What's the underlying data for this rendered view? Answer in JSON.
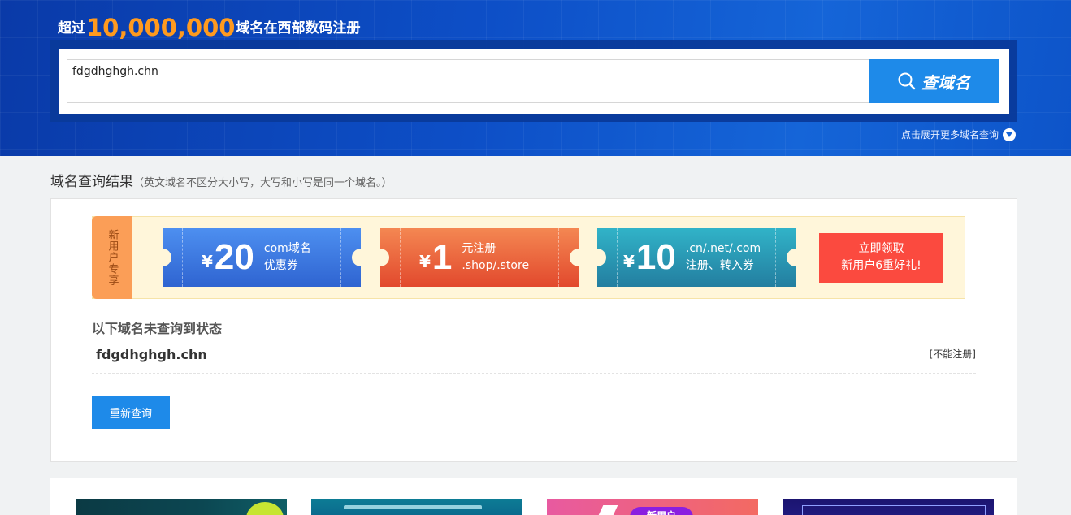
{
  "hero": {
    "title_prefix": "超过",
    "title_number": "10,000,000",
    "title_suffix": "域名在西部数码注册",
    "search_value": "fdgdhghgh.chn",
    "search_button": "查域名",
    "more_link": "点击展开更多域名查询"
  },
  "results": {
    "title": "域名查询结果",
    "note": "（英文域名不区分大小写，大写和小写是同一个域名。）",
    "promo": {
      "tag": "新用户专享",
      "coupons": [
        {
          "currency": "¥",
          "amount": "20",
          "line1": "com域名",
          "line2": "优惠券",
          "color": "#3a78e0"
        },
        {
          "currency": "¥",
          "amount": "1",
          "line1": "元注册",
          "line2": ".shop/.store",
          "color": "#ec6a3d"
        },
        {
          "currency": "¥",
          "amount": "10",
          "line1": ".cn/.net/.com",
          "line2": "注册、转入券",
          "color": "#2a99b5"
        }
      ],
      "gift_line1": "立即领取",
      "gift_line2": "新用户6重好礼!"
    },
    "fail_heading": "以下域名未查询到状态",
    "domain": "fdgdhghgh.chn",
    "status": "[不能注册]",
    "requery_button": "重新查询"
  },
  "bottom_banners": {
    "b3_pill": "新用户"
  },
  "colors": {
    "primary_blue": "#1e8ae9",
    "accent_orange": "#ff9a1f",
    "gift_red": "#fb4a3f"
  }
}
